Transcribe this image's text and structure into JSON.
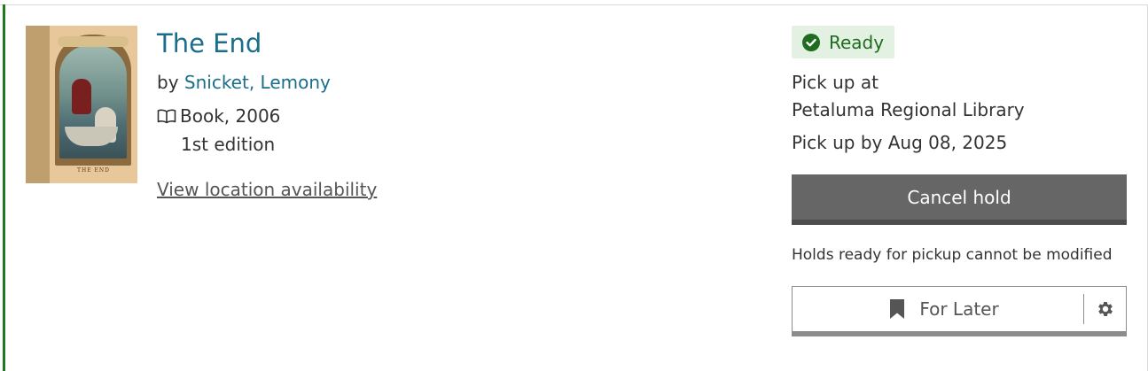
{
  "item": {
    "title": "The End",
    "by_prefix": "by",
    "author": "Snicket, Lemony",
    "format": "Book, 2006",
    "edition": "1st edition",
    "availability_link": "View location availability",
    "cover": {
      "alt_text": "THE END"
    }
  },
  "hold": {
    "status": "Ready",
    "status_color": "#1f6b1f",
    "pickup_label": "Pick up at",
    "pickup_location": "Petaluma Regional Library",
    "pickup_by": "Pick up by Aug 08, 2025",
    "cancel_label": "Cancel hold",
    "note": "Holds ready for pickup cannot be modified",
    "shelf_label": "For Later"
  },
  "icons": {
    "format": "book-open-icon",
    "status": "check-circle-icon",
    "shelf": "bookmark-icon",
    "settings": "gear-icon"
  },
  "colors": {
    "accent": "#1f7a1f",
    "link": "#1a6e8c",
    "button": "#666666"
  }
}
